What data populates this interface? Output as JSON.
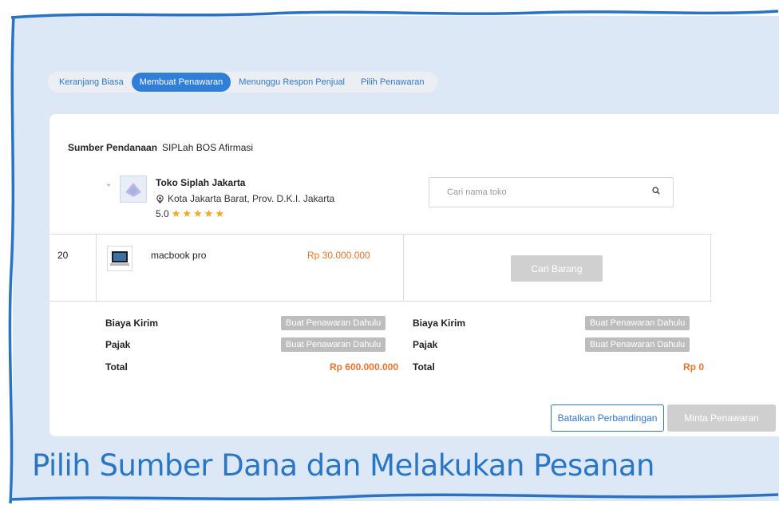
{
  "tabs": [
    {
      "label": "Keranjang Biasa",
      "active": false
    },
    {
      "label": "Membuat Penawaran",
      "active": true
    },
    {
      "label": "Menunggu Respon Penjual",
      "active": false
    },
    {
      "label": "Pilih Penawaran",
      "active": false
    }
  ],
  "funding": {
    "label": "Sumber Pendanaan",
    "value": "SIPLah BOS Afirmasi"
  },
  "store": {
    "name": "Toko Siplah Jakarta",
    "location": "Kota Jakarta Barat, Prov. D.K.I. Jakarta",
    "rating": "5.0",
    "stars": 5,
    "icon": "chevron-down-icon"
  },
  "search": {
    "placeholder": "Cari nama toko",
    "value": "",
    "icon": "search-icon"
  },
  "item": {
    "qty": "20",
    "name": "macbook pro",
    "price": "Rp 30.000.000"
  },
  "cari_barang_label": "Cari Barang",
  "summary_left": {
    "shipping_label": "Biaya Kirim",
    "shipping_value": "Buat Penawaran Dahulu",
    "tax_label": "Pajak",
    "tax_value": "Buat Penawaran Dahulu",
    "total_label": "Total",
    "total_value": "Rp 600.000.000"
  },
  "summary_right": {
    "shipping_label": "Biaya Kirim",
    "shipping_value": "Buat Penawaran Dahulu",
    "tax_label": "Pajak",
    "tax_value": "Buat Penawaran Dahulu",
    "total_label": "Total",
    "total_value": "Rp 0"
  },
  "actions": {
    "cancel_label": "Batalkan Perbandingan",
    "request_label": "Minta Penawaran"
  },
  "caption": "Pilih Sumber Dana dan Melakukan Pesanan",
  "colors": {
    "accent": "#2f7fd8",
    "price": "#e8742c",
    "panel": "#dce8f5",
    "frame": "#2a73c4"
  }
}
